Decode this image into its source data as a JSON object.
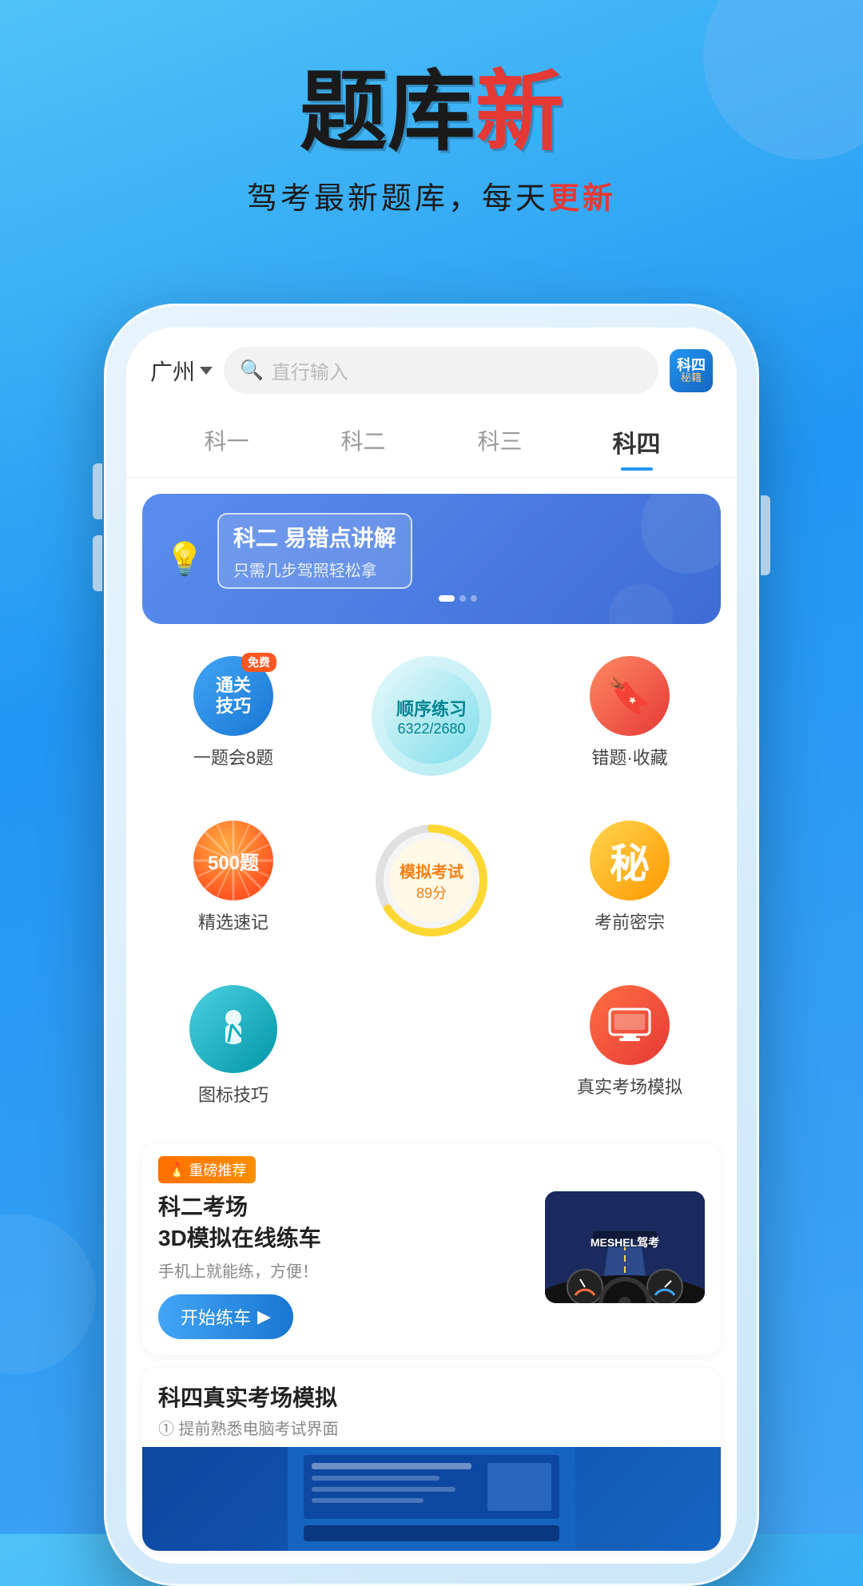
{
  "app": {
    "background_gradient_start": "#4fc3f7",
    "background_gradient_end": "#2196f3",
    "accent_blue": "#2196f3",
    "accent_red": "#e53935"
  },
  "header": {
    "title_black": "题库",
    "title_red": "新",
    "subtitle": "驾考最新题库，每天",
    "subtitle_highlight": "更新"
  },
  "phone": {
    "topbar": {
      "location": "广州",
      "location_arrow": "▼",
      "search_placeholder": "直行输入",
      "ke4_label": "科四",
      "ke4_sublabel": "秘籍"
    },
    "tabs": [
      {
        "label": "科一",
        "active": false
      },
      {
        "label": "科二",
        "active": false
      },
      {
        "label": "科三",
        "active": false
      },
      {
        "label": "科四",
        "active": true
      }
    ],
    "banner": {
      "icon": "💡",
      "title": "科二 易错点讲解",
      "subtitle": "只需几步驾照轻松拿"
    },
    "grid_items": [
      {
        "id": "tongguanjiqiao",
        "label": "一题会8题",
        "icon_text": "通关\n技巧",
        "free_badge": "免费",
        "color": "blue"
      },
      {
        "id": "shunxu",
        "label": "顺序练习",
        "count": "6322/2680",
        "color": "teal_circle"
      },
      {
        "id": "cuoti",
        "label": "错题·收藏",
        "icon": "bookmark",
        "color": "orange"
      }
    ],
    "grid_items_row2": [
      {
        "id": "jingxuan",
        "label": "精选速记",
        "icon_main": "500题",
        "color": "red_orange"
      },
      {
        "id": "moni",
        "label": "模拟考试",
        "score": "89分",
        "color": "gold_circle"
      },
      {
        "id": "kaomian",
        "label": "考前密宗",
        "icon_text": "秘",
        "color": "gold"
      }
    ],
    "grid_items_row3": [
      {
        "id": "tubiao",
        "label": "图标技巧",
        "icon": "seatbelt",
        "color": "teal"
      },
      {
        "id": "empty",
        "label": "",
        "color": "none"
      },
      {
        "id": "zhenshimoni",
        "label": "真实考场模拟",
        "icon": "monitor",
        "color": "red"
      }
    ],
    "promo_card": {
      "badge_fire": "🔥",
      "badge_text": "重磅推荐",
      "title": "科二考场\n3D模拟在线练车",
      "desc": "手机上就能练，方便！",
      "button_text": "开始练车",
      "button_arrow": "▶",
      "image_brand": "MESHEL驾考"
    },
    "feature_card": {
      "title": "科四真实考场模拟",
      "subtitle": "① 提前熟悉电脑考试界面"
    }
  }
}
